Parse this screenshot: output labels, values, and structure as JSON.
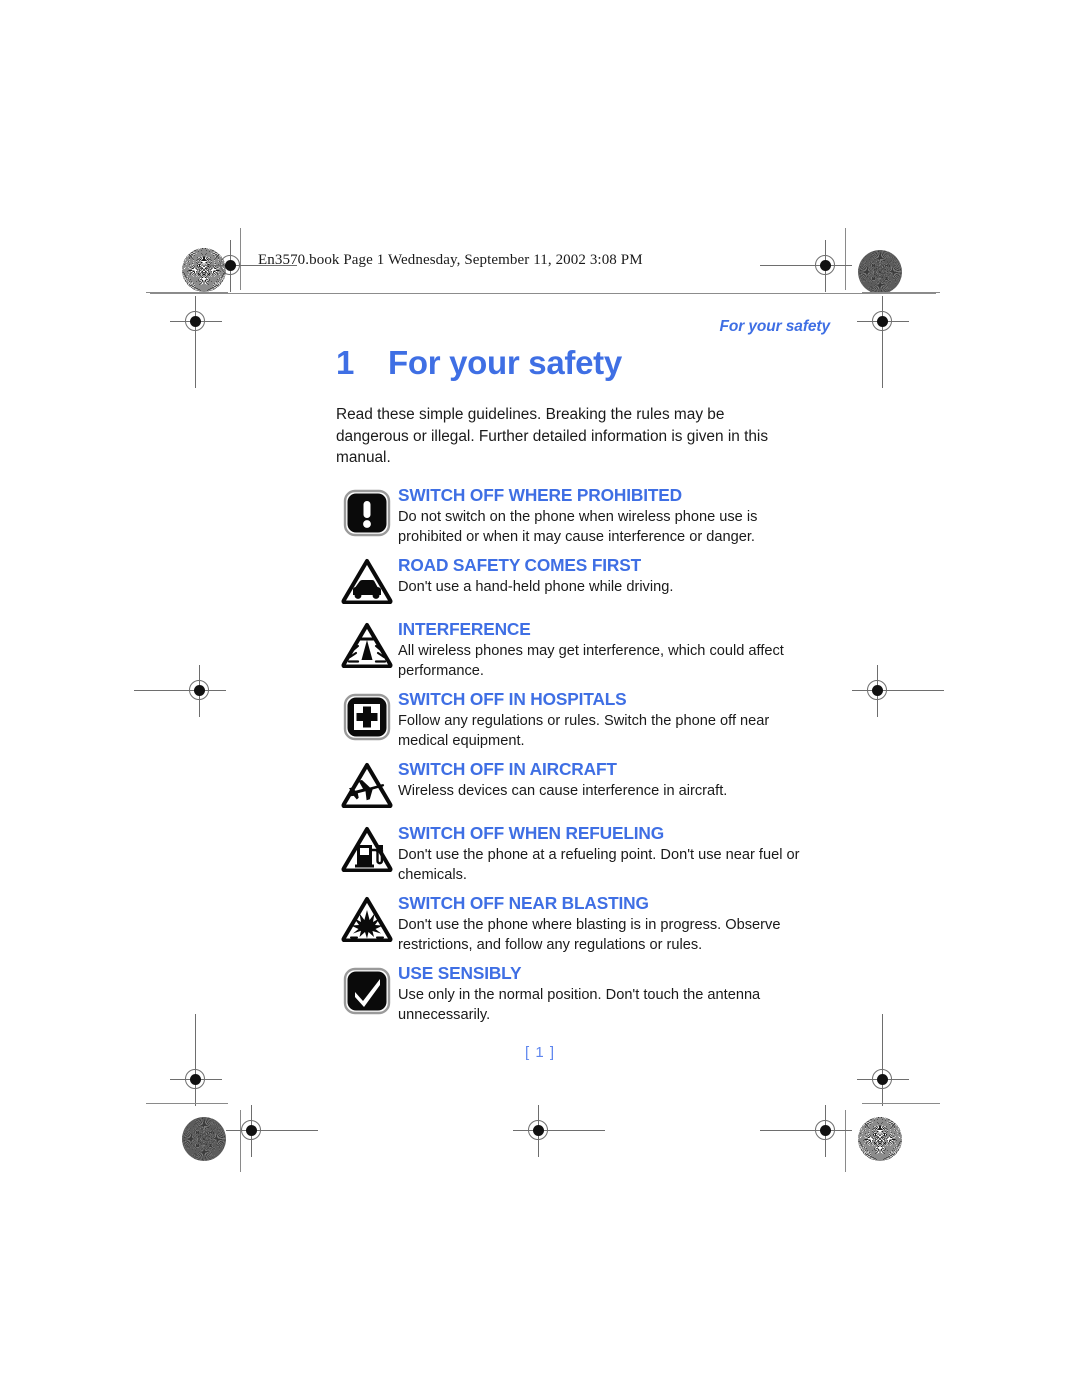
{
  "print_header": {
    "text": "En3570.book  Page 1  Wednesday, September 11, 2002  3:08 PM"
  },
  "running_head": {
    "text": "For your safety"
  },
  "chapter": {
    "number": "1",
    "title": "For your safety",
    "intro": "Read these simple guidelines. Breaking the rules may be dangerous or illegal. Further detailed information is given in this manual."
  },
  "colors": {
    "heading_blue": "#3f6fe4",
    "body_black": "#1a1a1a",
    "page_number_blue": "#5e86ee"
  },
  "safety_items": [
    {
      "icon": "exclamation-square-icon",
      "icon_shape": "square",
      "heading": "SWITCH OFF WHERE PROHIBITED",
      "body": "Do not switch on the phone when wireless phone use is prohibited or when it may cause interference or danger."
    },
    {
      "icon": "car-triangle-icon",
      "icon_shape": "triangle",
      "heading": "ROAD SAFETY COMES FIRST",
      "body": "Don't use a hand-held phone while driving."
    },
    {
      "icon": "interference-triangle-icon",
      "icon_shape": "triangle",
      "heading": "INTERFERENCE",
      "body": "All wireless phones may get interference, which could affect performance."
    },
    {
      "icon": "hospital-cross-square-icon",
      "icon_shape": "square",
      "heading": "SWITCH OFF IN HOSPITALS",
      "body": "Follow any regulations or rules. Switch the phone off near medical equipment."
    },
    {
      "icon": "airplane-triangle-icon",
      "icon_shape": "triangle",
      "heading": "SWITCH OFF IN AIRCRAFT",
      "body": "Wireless devices can cause interference in aircraft."
    },
    {
      "icon": "fuel-pump-triangle-icon",
      "icon_shape": "triangle",
      "heading": "SWITCH OFF WHEN REFUELING",
      "body": "Don't use the phone at a refueling point. Don't use near fuel or chemicals."
    },
    {
      "icon": "blasting-explosion-triangle-icon",
      "icon_shape": "triangle",
      "heading": "SWITCH OFF NEAR BLASTING",
      "body": "Don't use the phone where blasting is in progress. Observe restrictions, and follow any regulations or rules."
    },
    {
      "icon": "checkmark-square-icon",
      "icon_shape": "square",
      "heading": "USE SENSIBLY",
      "body": "Use only in the normal position. Don't touch the antenna unnecessarily."
    }
  ],
  "footer": {
    "page_number": "[ 1 ]"
  }
}
